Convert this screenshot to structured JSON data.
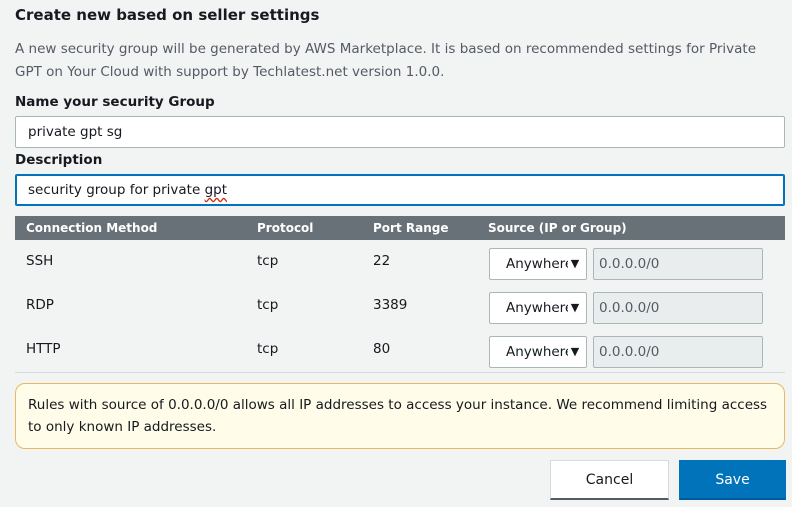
{
  "title": "Create new based on seller settings",
  "description": "A new security group will be generated by AWS Marketplace. It is based on recommended settings for Private GPT on Your Cloud with support by Techlatest.net version 1.0.0.",
  "name_field": {
    "label": "Name your security Group",
    "value": "private gpt sg"
  },
  "description_field": {
    "label": "Description",
    "value_prefix": "security group for private ",
    "value_misspelled": "gpt"
  },
  "table": {
    "headers": [
      "Connection Method",
      "Protocol",
      "Port Range",
      "Source (IP or Group)"
    ],
    "rows": [
      {
        "method": "SSH",
        "protocol": "tcp",
        "port": "22",
        "source_type": "Anywhere",
        "cidr": "0.0.0.0/0"
      },
      {
        "method": "RDP",
        "protocol": "tcp",
        "port": "3389",
        "source_type": "Anywhere",
        "cidr": "0.0.0.0/0"
      },
      {
        "method": "HTTP",
        "protocol": "tcp",
        "port": "80",
        "source_type": "Anywhere",
        "cidr": "0.0.0.0/0"
      }
    ]
  },
  "warning": "Rules with source of 0.0.0.0/0 allows all IP addresses to access your instance. We recommend limiting access to only known IP addresses.",
  "buttons": {
    "cancel": "Cancel",
    "save": "Save"
  },
  "icons": {
    "select_chevron": "chevron-down-icon"
  },
  "colors": {
    "primary": "#0073bb",
    "table_header": "#687078",
    "warning_bg": "#fffce9",
    "warning_border": "#e6ba5d"
  }
}
